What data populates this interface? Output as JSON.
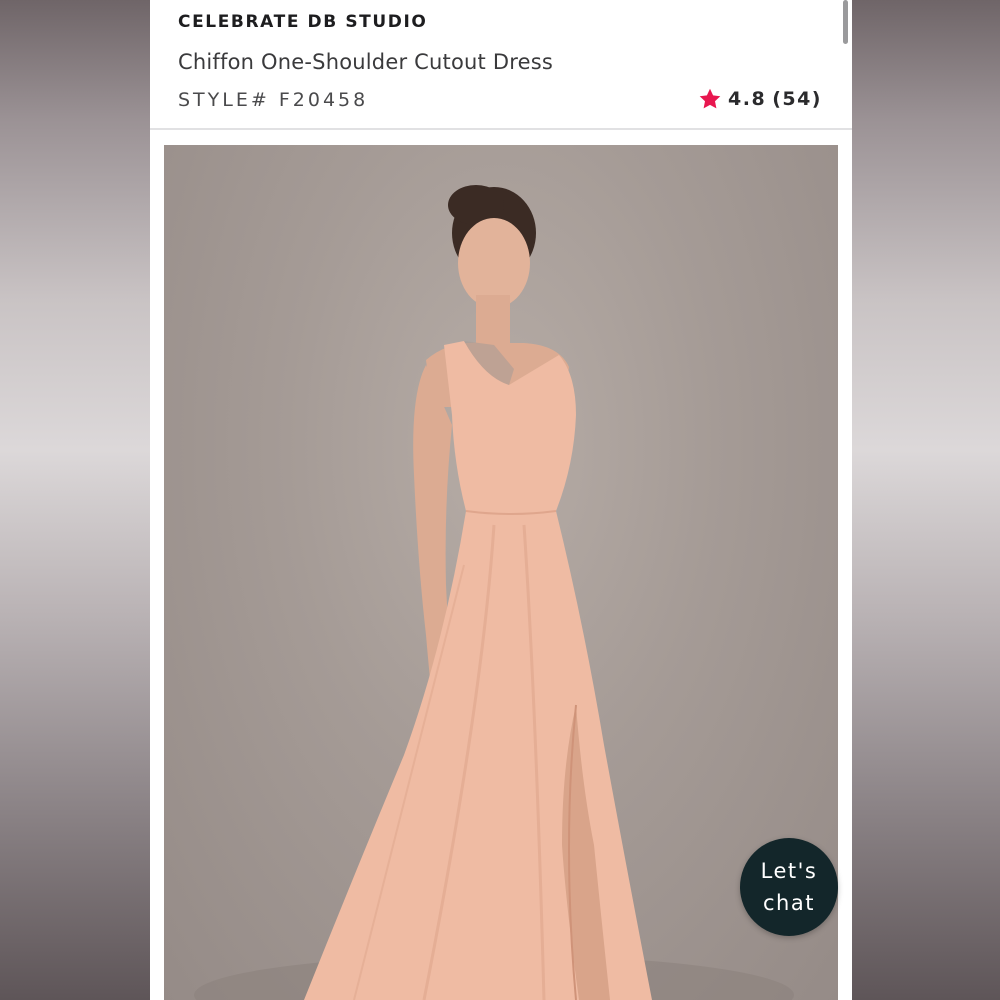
{
  "product": {
    "brand": "CELEBRATE DB STUDIO",
    "title": "Chiffon One-Shoulder Cutout Dress",
    "style_label": "STYLE#",
    "style_number": "F20458",
    "rating": "4.8",
    "review_count": "(54)"
  },
  "image": {
    "icon": "product-photo",
    "dress_color": "#eeb9a2"
  },
  "chat": {
    "line1": "Let's",
    "line2": "chat"
  },
  "colors": {
    "star": "#e8174f",
    "chat_bg": "#13262a",
    "background_panel": "#a59b96"
  }
}
